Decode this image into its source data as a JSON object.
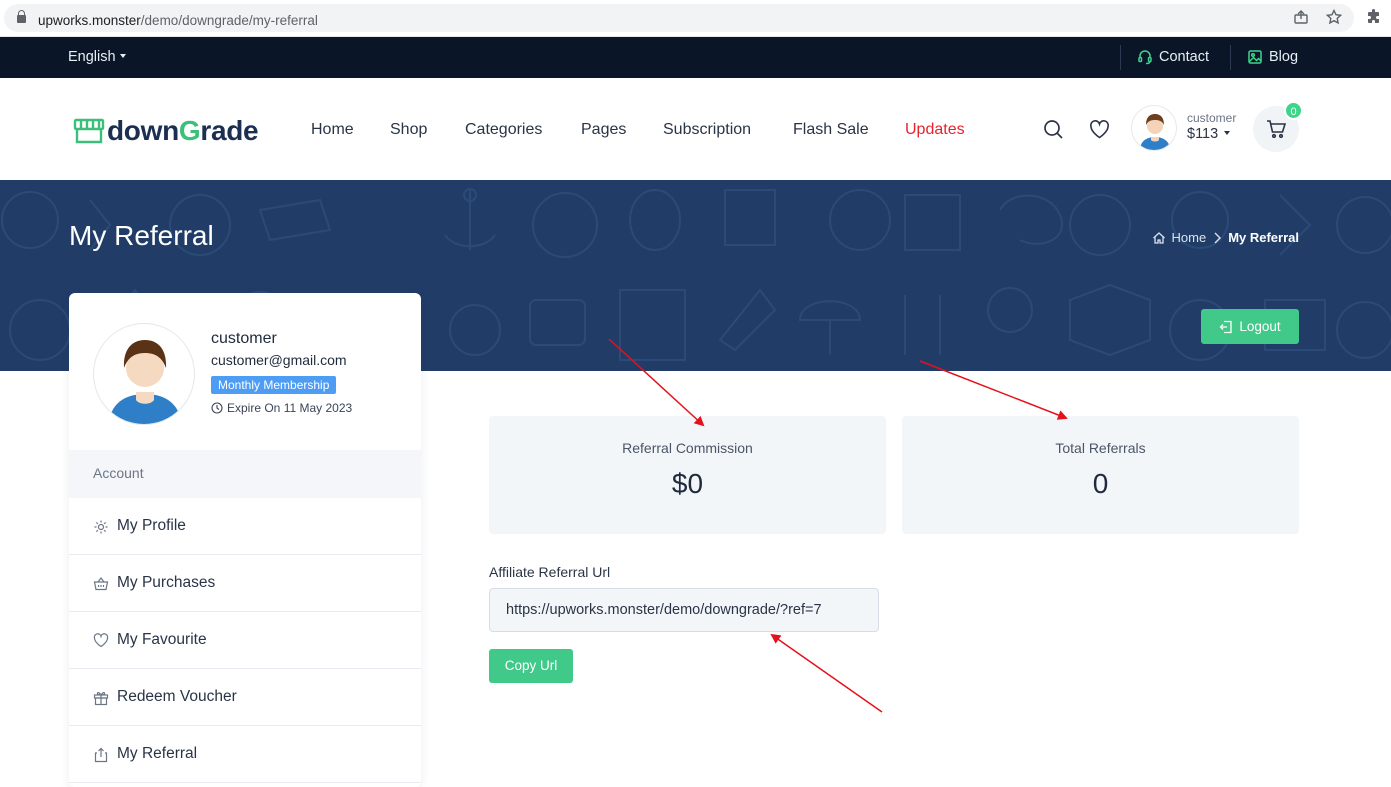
{
  "browser": {
    "url_host": "upworks.monster",
    "url_path": "/demo/downgrade/my-referral"
  },
  "topbar": {
    "language": "English",
    "contact": "Contact",
    "blog": "Blog"
  },
  "header": {
    "logo_prefix": "down",
    "logo_g": "G",
    "logo_suffix": "rade",
    "nav": [
      "Home",
      "Shop",
      "Categories",
      "Pages",
      "Subscription",
      "Flash Sale",
      "Updates"
    ],
    "user_name": "customer",
    "user_balance": "$113",
    "cart_count": "0"
  },
  "banner": {
    "title": "My Referral",
    "breadcrumb_home": "Home",
    "breadcrumb_current": "My Referral",
    "logout": "Logout"
  },
  "profile": {
    "name": "customer",
    "email": "customer@gmail.com",
    "membership": "Monthly Membership",
    "expire": "Expire On 11 May 2023",
    "section": "Account",
    "menu": [
      "My Profile",
      "My Purchases",
      "My Favourite",
      "Redeem Voucher",
      "My Referral"
    ]
  },
  "stats": {
    "commission_label": "Referral Commission",
    "commission_value": "$0",
    "referrals_label": "Total Referrals",
    "referrals_value": "0"
  },
  "affiliate": {
    "label": "Affiliate Referral Url",
    "url": "https://upworks.monster/demo/downgrade/?ref=7",
    "copy_button": "Copy Url"
  },
  "colors": {
    "accent_green": "#41c98a",
    "banner_bg": "#213d67",
    "topbar_bg": "#0a1628",
    "highlight_red": "#e8232d",
    "annotation_arrow": "#e3121b"
  }
}
